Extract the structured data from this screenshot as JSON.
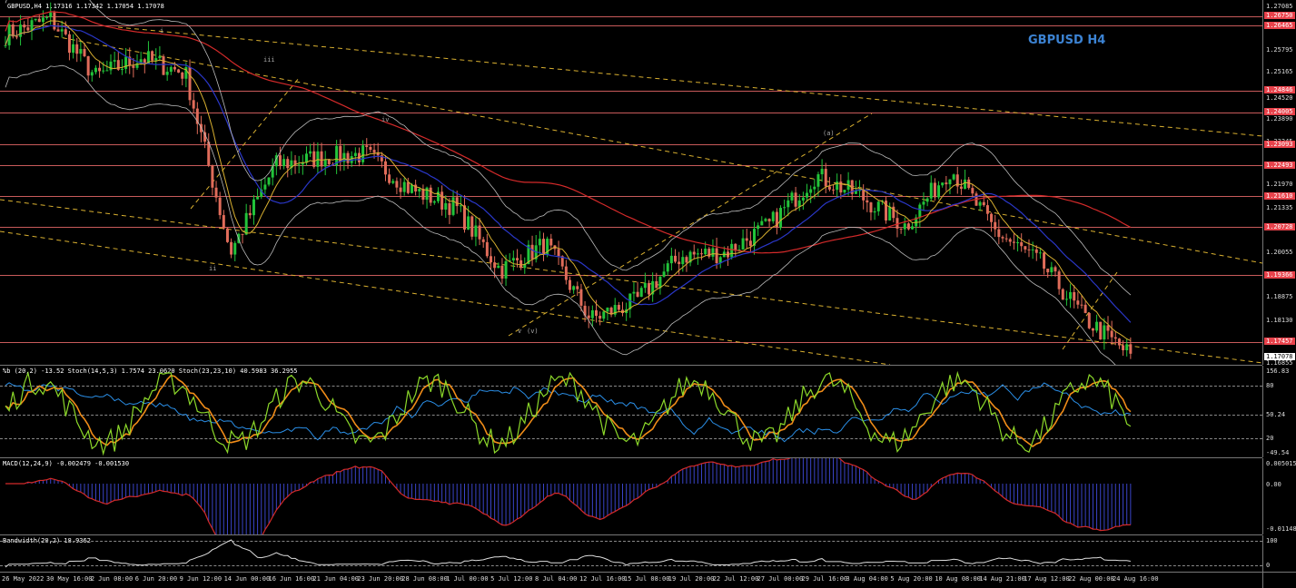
{
  "header": {
    "info": "GBPUSD,H4  1.17316 1.17342 1.17054 1.17078"
  },
  "chart_title": "GBPUSD H4",
  "price_axis": {
    "ticks": [
      "1.27085",
      "1.25795",
      "1.25165",
      "1.24520",
      "1.23890",
      "1.23245",
      "1.21970",
      "1.21335",
      "1.20055",
      "1.18875",
      "1.18130",
      "1.16855"
    ],
    "levels": [
      "1.26750",
      "1.26465",
      "1.24846",
      "1.24005",
      "1.23093",
      "1.22493",
      "1.21610",
      "1.20728",
      "1.19366",
      "1.17457"
    ],
    "current": "1.17078"
  },
  "wave_labels": [
    "i",
    "ii",
    "iii",
    "iv",
    "v",
    "(v)",
    "(a)"
  ],
  "indicators": {
    "stoch": {
      "title": "%b (20,2) -13.52  Stoch(14,5,3) 1.7574 23.0620  Stoch(23,23,10) 40.5983 36.2955",
      "ticks": [
        "156.83",
        "80",
        "50.24",
        "20",
        "-49.54"
      ]
    },
    "macd": {
      "title": "MACD(12,24,9) -0.002479 -0.001530",
      "ticks": [
        "0.005015",
        "0.00",
        "-0.011489"
      ]
    },
    "bandwidth": {
      "title": "Bandwidth(20,2) 18.9362",
      "ticks": [
        "100",
        "0"
      ]
    }
  },
  "time_axis": [
    "26 May 2022",
    "30 May 16:00",
    "2 Jun 08:00",
    "6 Jun 20:00",
    "9 Jun 12:00",
    "14 Jun 00:00",
    "16 Jun 16:00",
    "21 Jun 04:00",
    "23 Jun 20:00",
    "28 Jun 08:00",
    "1 Jul 00:00",
    "5 Jul 12:00",
    "8 Jul 04:00",
    "12 Jul 16:00",
    "15 Jul 08:00",
    "19 Jul 20:00",
    "22 Jul 12:00",
    "27 Jul 00:00",
    "29 Jul 16:00",
    "3 Aug 04:00",
    "5 Aug 20:00",
    "10 Aug 08:00",
    "14 Aug 21:00",
    "17 Aug 12:00",
    "22 Aug 00:00",
    "24 Aug 16:00"
  ],
  "colors": {
    "bull": "#22c43a",
    "bear": "#e06c5a",
    "ma_red": "#d42a2a",
    "ma_blue": "#2a37c8",
    "band": "#bbbbbb",
    "fib": "#d9b030",
    "stoch_fast": "#8cd92a",
    "stoch_slow": "#f08c18",
    "stoch_mid": "#2a8ee6"
  },
  "chart_data": {
    "type": "candlestick",
    "symbol": "GBPUSD",
    "timeframe": "H4",
    "ylim": [
      1.16855,
      1.27085
    ],
    "close_path": [
      {
        "x": "26 May 2022",
        "y": 1.262
      },
      {
        "x": "30 May 16:00",
        "y": 1.2665
      },
      {
        "x": "2 Jun 08:00",
        "y": 1.25
      },
      {
        "x": "6 Jun 20:00",
        "y": 1.2555
      },
      {
        "x": "9 Jun 12:00",
        "y": 1.251
      },
      {
        "x": "14 Jun 00:00",
        "y": 1.2
      },
      {
        "x": "16 Jun 16:00",
        "y": 1.225
      },
      {
        "x": "21 Jun 04:00",
        "y": 1.227
      },
      {
        "x": "23 Jun 20:00",
        "y": 1.228
      },
      {
        "x": "28 Jun 08:00",
        "y": 1.218
      },
      {
        "x": "1 Jul 00:00",
        "y": 1.213
      },
      {
        "x": "5 Jul 12:00",
        "y": 1.195
      },
      {
        "x": "8 Jul 04:00",
        "y": 1.2025
      },
      {
        "x": "12 Jul 16:00",
        "y": 1.181
      },
      {
        "x": "15 Jul 08:00",
        "y": 1.186
      },
      {
        "x": "19 Jul 20:00",
        "y": 1.199
      },
      {
        "x": "22 Jul 12:00",
        "y": 1.2
      },
      {
        "x": "27 Jul 00:00",
        "y": 1.208
      },
      {
        "x": "29 Jul 16:00",
        "y": 1.222
      },
      {
        "x": "3 Aug 04:00",
        "y": 1.216
      },
      {
        "x": "5 Aug 20:00",
        "y": 1.2075
      },
      {
        "x": "10 Aug 08:00",
        "y": 1.224
      },
      {
        "x": "14 Aug 21:00",
        "y": 1.206
      },
      {
        "x": "17 Aug 12:00",
        "y": 1.197
      },
      {
        "x": "22 Aug 00:00",
        "y": 1.181
      },
      {
        "x": "24 Aug 16:00",
        "y": 1.1708
      }
    ]
  }
}
